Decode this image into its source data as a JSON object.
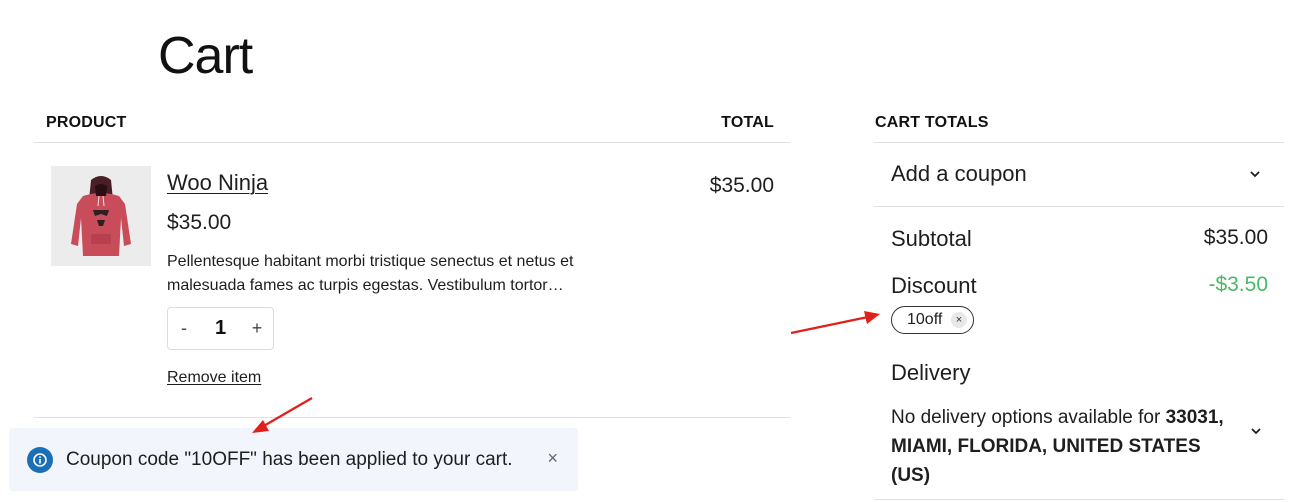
{
  "page": {
    "title": "Cart"
  },
  "table": {
    "product_header": "PRODUCT",
    "total_header": "TOTAL"
  },
  "item": {
    "name": "Woo Ninja",
    "price": "$35.00",
    "description": "Pellentesque habitant morbi tristique senectus et netus et malesuada fames ac turpis egestas. Vestibulum tortor…",
    "quantity": "1",
    "qty_decrease": "-",
    "qty_increase": "+",
    "remove_label": "Remove item",
    "line_total": "$35.00",
    "thumbnail_icon": "hoodie-image"
  },
  "notice": {
    "text": "Coupon code \"10OFF\" has been applied to your cart.",
    "close": "×",
    "icon": "info-icon",
    "icon_color": "#1b6fb7"
  },
  "totals": {
    "header": "CART TOTALS",
    "coupon_toggle": "Add a coupon",
    "subtotal_label": "Subtotal",
    "subtotal_value": "$35.00",
    "discount_label": "Discount",
    "discount_value": "-$3.50",
    "discount_color": "#4ab866",
    "coupon_code": "10off",
    "coupon_remove": "×",
    "delivery_label": "Delivery",
    "delivery_prefix": "No delivery options available for ",
    "delivery_location": "33031, MIAMI, FLORIDA, UNITED STATES (US)"
  },
  "annotation_color": "#e0201b"
}
